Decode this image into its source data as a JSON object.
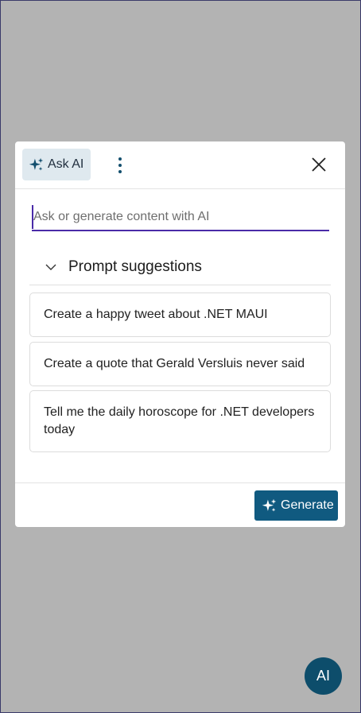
{
  "dialog": {
    "ask_ai_label": "Ask AI",
    "input": {
      "placeholder": "Ask or generate content with AI",
      "value": ""
    },
    "suggestions_title": "Prompt suggestions",
    "suggestions": [
      "Create a happy tweet about .NET MAUI",
      "Create a quote that Gerald Versluis never said",
      "Tell me the daily horoscope for .NET developers today"
    ],
    "generate_label": "Generate"
  },
  "fab": {
    "label": "AI"
  },
  "icons": {
    "ask_ai": "sparkle-icon",
    "more": "more-vertical-icon",
    "close": "close-icon",
    "chevron": "chevron-down-icon",
    "generate": "sparkle-icon"
  },
  "colors": {
    "accent": "#105a80",
    "fab": "#0d4d6b",
    "input_underline": "#4a2ba8",
    "ask_ai_bg": "#dfe9ef",
    "overlay": "#b3b3b3"
  }
}
